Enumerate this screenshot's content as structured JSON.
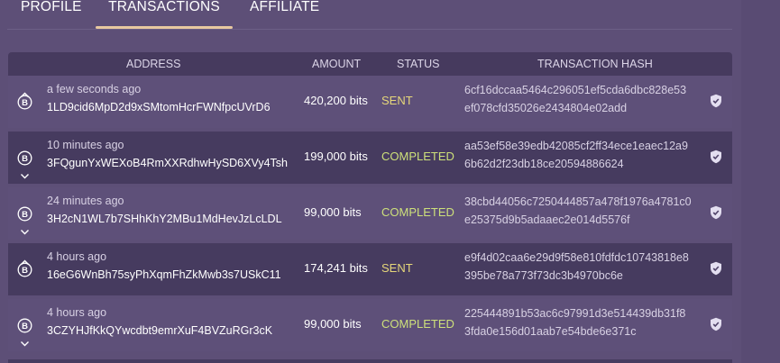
{
  "tabs": [
    {
      "label": "PROFILE",
      "active": false
    },
    {
      "label": "TRANSACTIONS",
      "active": true
    },
    {
      "label": "AFFILIATE",
      "active": false
    }
  ],
  "table": {
    "headers": {
      "address": "ADDRESS",
      "amount": "AMOUNT",
      "status": "STATUS",
      "hash": "TRANSACTION HASH"
    },
    "rows": [
      {
        "time": "a few seconds ago",
        "address": "1LD9cid6MpD2d9xSMtomHcrFWNfpcUVrD6",
        "amount": "420,200 bits",
        "status": "SENT",
        "hash": "6cf16dccaa5464c296051ef5cda6dbc828e53ef078cfd35026e2434804e02add",
        "direction": "up"
      },
      {
        "time": "10 minutes ago",
        "address": "3FQgunYxWEXoB4RmXXRdhwHySD6XVy4Tsh",
        "amount": "199,000 bits",
        "status": "COMPLETED",
        "hash": "aa53ef58e39edb42085cf2ff34ece1eaec12a96b62d2f23db18ce20594886624",
        "direction": "down"
      },
      {
        "time": "24 minutes ago",
        "address": "3H2cN1WL7b7SHhKhY2MBu1MdHevJzLcLDL",
        "amount": "99,000 bits",
        "status": "COMPLETED",
        "hash": "38cbd44056c7250444857a478f1976a4781c0e25375d9b5adaaec2e014d5576f",
        "direction": "down"
      },
      {
        "time": "4 hours ago",
        "address": "16eG6WnBh75syPhXqmFhZkMwb3s7USkC11",
        "amount": "174,241 bits",
        "status": "SENT",
        "hash": "e9f4d02caa6e29d9f58e810fdfdc10743818e8395be78a773f73dc3b4970bc6e",
        "direction": "up"
      },
      {
        "time": "4 hours ago",
        "address": "3CZYHJfKkQYwcdbt9emrXuF4BVZuRGr3cK",
        "amount": "99,000 bits",
        "status": "COMPLETED",
        "hash": "225444891b53ac6c97991d3e514439db31f83fda0e156d01aab7e54bde6e371c",
        "direction": "down"
      }
    ]
  },
  "icons": {
    "coin": "bitcoin-icon",
    "direction_up": "caret-up-icon",
    "direction_down": "caret-down-icon",
    "verify": "shield-check-icon"
  },
  "colors": {
    "background": "#5d4f77",
    "active_tab_underline": "#e8c9a0",
    "sent": "#e6d77a",
    "completed": "#cde07a"
  }
}
